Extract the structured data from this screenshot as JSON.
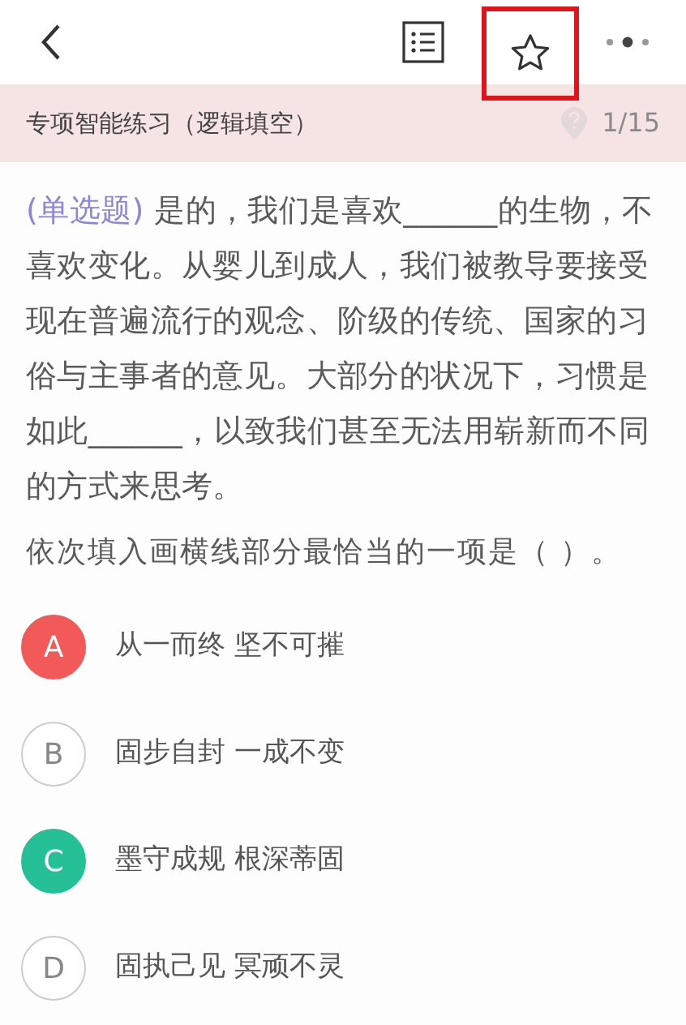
{
  "toolbar": {
    "star_highlighted": true
  },
  "header": {
    "title": "专项智能练习（逻辑填空）",
    "progress": "1/15"
  },
  "question": {
    "type_label": "(单选题)",
    "text": "是的，我们是喜欢______的生物，不喜欢变化。从婴儿到成人，我们被教导要接受现在普遍流行的观念、阶级的传统、国家的习俗与主事者的意见。大部分的状况下，习惯是如此______，以致我们甚至无法用崭新而不同的方式来思考。",
    "prompt": "依次填入画横线部分最恰当的一项是（    ）。"
  },
  "options": [
    {
      "letter": "A",
      "text": "从一而终 坚不可摧",
      "selected": true,
      "correct": false
    },
    {
      "letter": "B",
      "text": "固步自封 一成不变",
      "selected": false,
      "correct": false
    },
    {
      "letter": "C",
      "text": "墨守成规 根深蒂固",
      "selected": false,
      "correct": true
    },
    {
      "letter": "D",
      "text": "固执己见 冥顽不灵",
      "selected": false,
      "correct": false
    }
  ]
}
